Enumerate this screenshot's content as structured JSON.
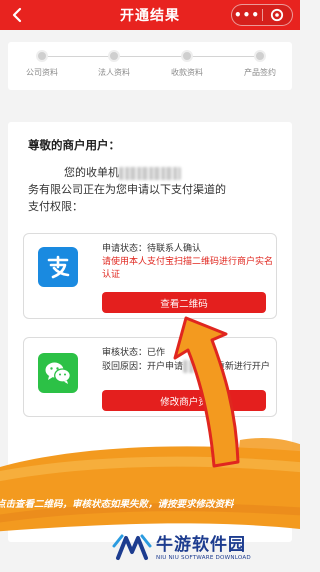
{
  "header": {
    "title": "开通结果",
    "more_label": "•••",
    "bg_color": "#e8231f"
  },
  "steps": [
    {
      "label": "公司资料"
    },
    {
      "label": "法人资料"
    },
    {
      "label": "收款资料"
    },
    {
      "label": "产品签约"
    }
  ],
  "notice": {
    "greeting": "尊敬的商户用户：",
    "line1_prefix": "您的收单机",
    "line2": "务有限公司正在为您申请以下支付渠道的",
    "line3": "支付权限："
  },
  "channels": [
    {
      "icon": "alipay-icon",
      "status": "申请状态：待联系人确认",
      "note": "请使用本人支付宝扫描二维码进行商户实名认证",
      "button": "查看二维码"
    },
    {
      "icon": "wechat-icon",
      "status": "审核状态：已作",
      "reason": "驳回原因：开户申请",
      "reason_tail": "资,请重新进行开户",
      "button": "修改商户资"
    }
  ],
  "instruction": "点击查看二维码，审核状态如果失败，请按要求修改资料",
  "watermark": {
    "cn": "牛游软件园",
    "en": "NIU NIU SOFTWARE DOWNLOAD"
  },
  "colors": {
    "accent_red": "#e41f1e",
    "alipay_blue": "#1a8ae0",
    "wechat_green": "#2cc146",
    "swoosh_orange": "#f39a1f"
  }
}
